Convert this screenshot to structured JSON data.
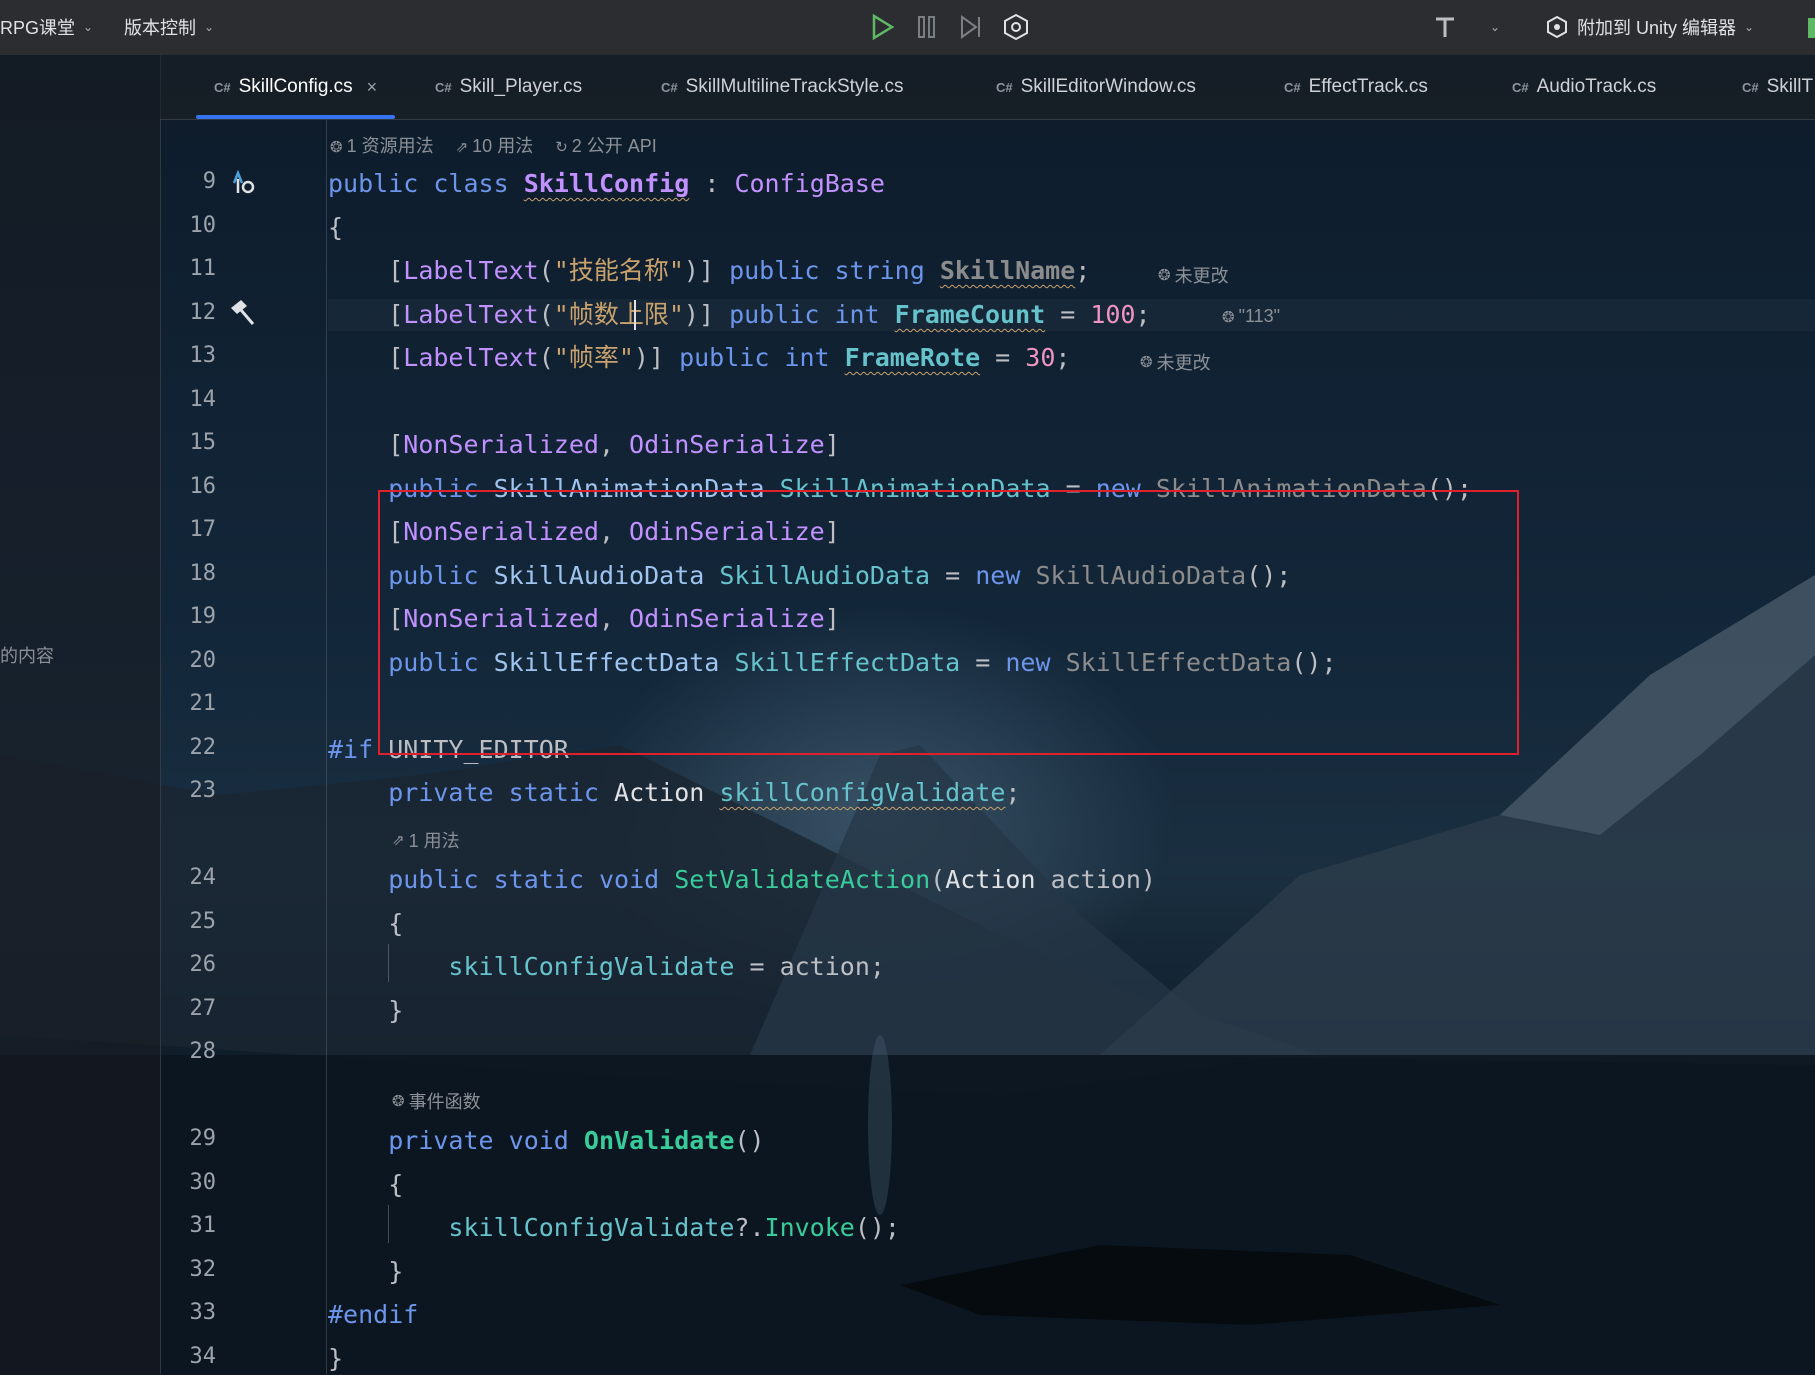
{
  "topbar": {
    "project_label": "RPG课堂",
    "vcs_label": "版本控制",
    "attach_label": "附加到 Unity 编辑器"
  },
  "tabs": [
    {
      "lang": "C#",
      "label": "SkillConfig.cs",
      "active": true,
      "close": "×"
    },
    {
      "lang": "C#",
      "label": "Skill_Player.cs"
    },
    {
      "lang": "C#",
      "label": "SkillMultilineTrackStyle.cs"
    },
    {
      "lang": "C#",
      "label": "SkillEditorWindow.cs"
    },
    {
      "lang": "C#",
      "label": "EffectTrack.cs"
    },
    {
      "lang": "C#",
      "label": "AudioTrack.cs"
    },
    {
      "lang": "C#",
      "label": "SkillT"
    }
  ],
  "sidebar": {
    "partial_text": "的内容"
  },
  "hints": {
    "class_usage": [
      "1 资源用法",
      "10 用法",
      "2 公开 API"
    ],
    "skillname_hint": "未更改",
    "framecount_hint": "\"113\"",
    "framerote_hint": "未更改",
    "action_usage": "1 用法",
    "event_func": "事件函数"
  },
  "line_numbers": [
    "9",
    "10",
    "11",
    "12",
    "13",
    "14",
    "15",
    "16",
    "17",
    "18",
    "19",
    "20",
    "21",
    "22",
    "23",
    "24",
    "25",
    "26",
    "27",
    "28",
    "29",
    "30",
    "31",
    "32",
    "33",
    "34"
  ],
  "code": {
    "l9": {
      "kw1": "public",
      "kw2": "class",
      "name": "SkillConfig",
      "colon": " : ",
      "base": "ConfigBase"
    },
    "l10": "{",
    "l11": {
      "attr": "LabelText",
      "str": "\"技能名称\"",
      "kw1": "public",
      "kw2": "string",
      "field": "SkillName"
    },
    "l12": {
      "attr": "LabelText",
      "str": "\"帧数上限\"",
      "kw1": "public",
      "kw2": "int",
      "field": "FrameCount",
      "num": "100"
    },
    "l13": {
      "attr": "LabelText",
      "str": "\"帧率\"",
      "kw1": "public",
      "kw2": "int",
      "field": "FrameRote",
      "num": "30"
    },
    "l15": {
      "a1": "NonSerialized",
      "a2": "OdinSerialize"
    },
    "l16": {
      "kw": "public",
      "type": "SkillAnimationData",
      "field": "SkillAnimationData",
      "new": "new",
      "ctor": "SkillAnimationData"
    },
    "l17": {
      "a1": "NonSerialized",
      "a2": "OdinSerialize"
    },
    "l18": {
      "kw": "public",
      "type": "SkillAudioData",
      "field": "SkillAudioData",
      "new": "new",
      "ctor": "SkillAudioData"
    },
    "l19": {
      "a1": "NonSerialized",
      "a2": "OdinSerialize"
    },
    "l20": {
      "kw": "public",
      "type": "SkillEffectData",
      "field": "SkillEffectData",
      "new": "new",
      "ctor": "SkillEffectData"
    },
    "l22": {
      "pp": "#if",
      "sym": "UNITY_EDITOR"
    },
    "l23": {
      "kw1": "private",
      "kw2": "static",
      "type": "Action",
      "field": "skillConfigValidate"
    },
    "l24": {
      "kw1": "public",
      "kw2": "static",
      "kw3": "void",
      "method": "SetValidateAction",
      "ptype": "Action",
      "pname": "action"
    },
    "l25": "{",
    "l26": {
      "field": "skillConfigValidate",
      "rhs": "action"
    },
    "l27": "}",
    "l29": {
      "kw1": "private",
      "kw2": "void",
      "method": "OnValidate"
    },
    "l30": "{",
    "l31": {
      "field": "skillConfigValidate",
      "method": "Invoke"
    },
    "l32": "}",
    "l33": "#endif",
    "l34": "}"
  }
}
